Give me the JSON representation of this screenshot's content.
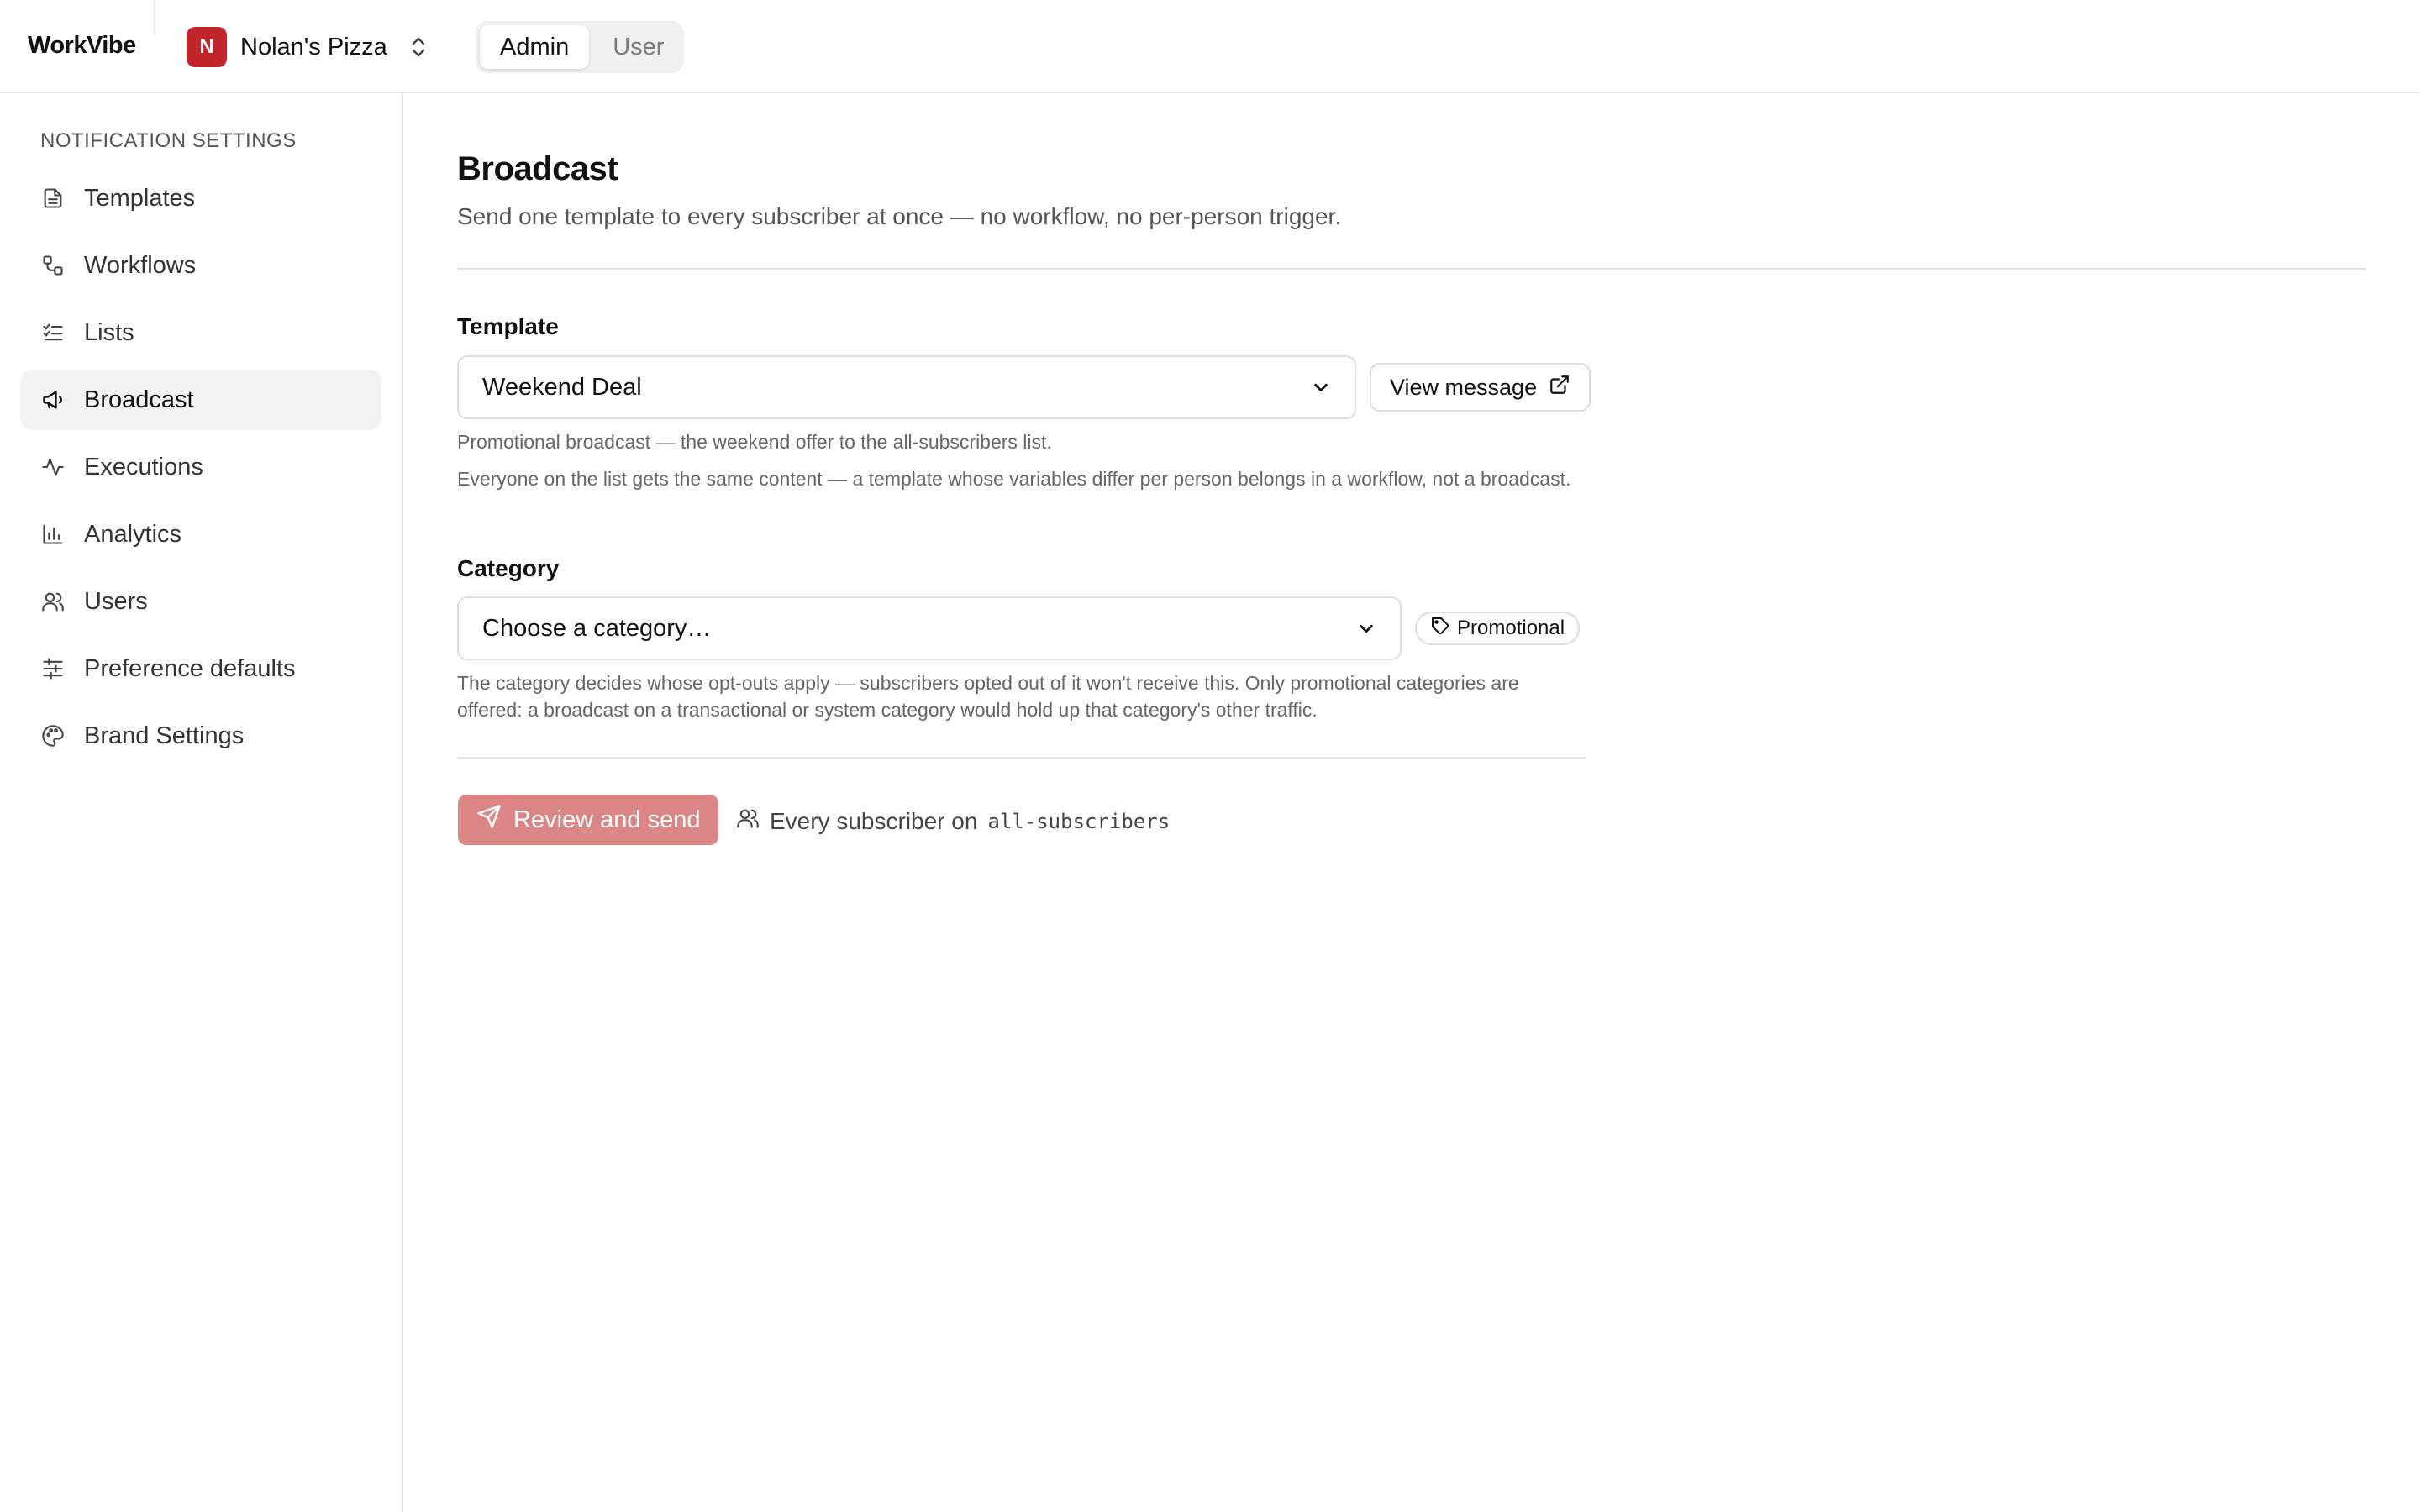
{
  "app": {
    "name": "WorkVibe"
  },
  "org": {
    "initial": "N",
    "name": "Nolan's Pizza",
    "avatar_color": "#c3262a"
  },
  "roles": [
    {
      "label": "Admin",
      "active": true
    },
    {
      "label": "User",
      "active": false
    }
  ],
  "sidebar": {
    "heading": "NOTIFICATION SETTINGS",
    "items": [
      {
        "label": "Templates",
        "icon": "document-icon",
        "active": false
      },
      {
        "label": "Workflows",
        "icon": "workflow-icon",
        "active": false
      },
      {
        "label": "Lists",
        "icon": "checklist-icon",
        "active": false
      },
      {
        "label": "Broadcast",
        "icon": "megaphone-icon",
        "active": true
      },
      {
        "label": "Executions",
        "icon": "activity-icon",
        "active": false
      },
      {
        "label": "Analytics",
        "icon": "bar-chart-icon",
        "active": false
      },
      {
        "label": "Users",
        "icon": "users-icon",
        "active": false
      },
      {
        "label": "Preference defaults",
        "icon": "sliders-icon",
        "active": false
      },
      {
        "label": "Brand Settings",
        "icon": "palette-icon",
        "active": false
      }
    ]
  },
  "page": {
    "title": "Broadcast",
    "subtitle": "Send one template to every subscriber at once — no workflow, no per-person trigger."
  },
  "template_field": {
    "label": "Template",
    "selected": "Weekend Deal",
    "view_button": "View message",
    "description": "Promotional broadcast — the weekend offer to the all-subscribers list.",
    "note": "Everyone on the list gets the same content — a template whose variables differ per person belongs in a workflow, not a broadcast."
  },
  "category_field": {
    "label": "Category",
    "placeholder": "Choose a category…",
    "tag": "Promotional",
    "help": "The category decides whose opt-outs apply — subscribers opted out of it won't receive this. Only promotional categories are offered: a broadcast on a transactional or system category would hold up that category's other traffic."
  },
  "actions": {
    "send_button": "Review and send",
    "audience_prefix": "Every subscriber on",
    "audience_list": "all-subscribers"
  },
  "colors": {
    "accent": "#c3262a",
    "primary_button_disabled": "#dc8585"
  }
}
